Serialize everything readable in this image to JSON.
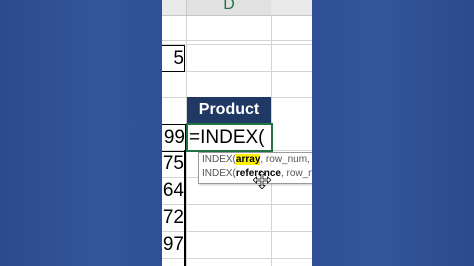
{
  "column": {
    "letter": "D"
  },
  "cells": {
    "top_value": "5",
    "header": "Product",
    "row_values": [
      "99",
      "75",
      "64",
      "72",
      "97"
    ]
  },
  "formula": {
    "text": "=INDEX("
  },
  "tooltip": {
    "line1": {
      "func": "INDEX(",
      "arg1": "array",
      "rest": ", row_num, ["
    },
    "line2": {
      "func": "INDEX(",
      "arg1": "reference",
      "rest": ", row_nu"
    }
  },
  "colors": {
    "accent": "#217346",
    "header_fill": "#1f3864",
    "highlight": "#fff200"
  },
  "icons": {
    "cursor": "move-cursor-icon"
  }
}
